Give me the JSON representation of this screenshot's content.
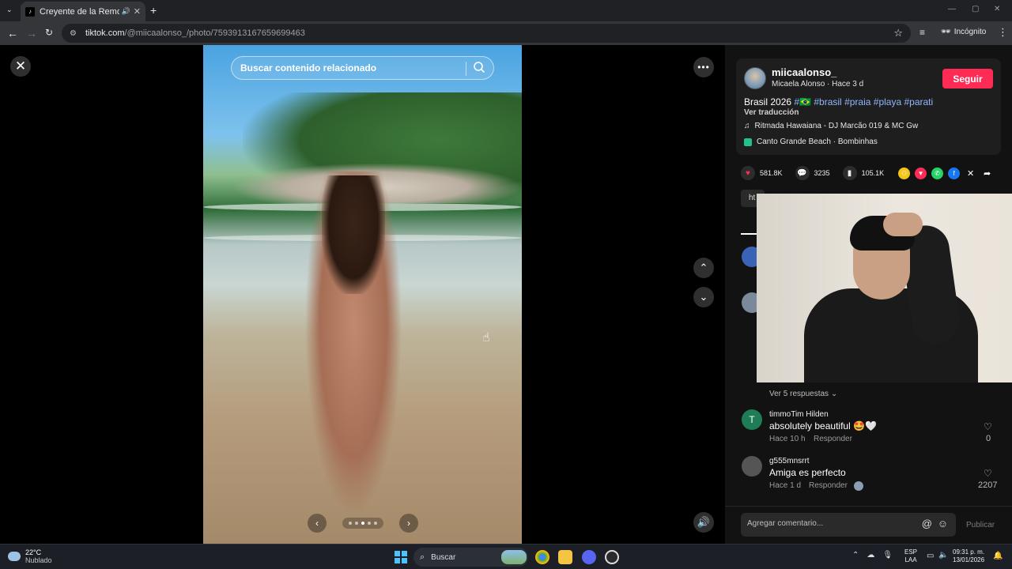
{
  "browser": {
    "tab_title": "Creyente de la Remontado",
    "url_host": "tiktok.com",
    "url_path": "/@miicaalonso_/photo/7593913167659699463",
    "incognito_label": "Incógnito"
  },
  "photo": {
    "search_placeholder": "Buscar contenido relacionado",
    "carousel_total": 5,
    "carousel_active": 3
  },
  "post": {
    "username": "miicaalonso_",
    "subtitle": "Micaela Alonso · Hace 3 d",
    "follow_label": "Seguir",
    "caption_text": "Brasil 2026",
    "hashtags": [
      "#🇧🇷",
      "#brasil",
      "#praia",
      "#playa",
      "#parati"
    ],
    "translate_label": "Ver traducción",
    "music": "Ritmada Hawaiana - DJ Marcão 019 & MC Gw",
    "location": "Canto Grande Beach · Bombinhas",
    "likes": "581.8K",
    "comments": "3235",
    "saves": "105.1K",
    "link_stub": "ht"
  },
  "comments": {
    "replies_label": "Ver 5 respuestas",
    "items": [
      {
        "author": "timmoTim Hilden",
        "avatar_letter": "T",
        "text": "absolutely beautiful 🤩🤍",
        "time": "Hace 10 h",
        "reply": "Responder",
        "likes": "0"
      },
      {
        "author": "g555mnsrrt",
        "avatar_letter": "",
        "text": "Amiga es perfecto",
        "time": "Hace 1 d",
        "reply": "Responder",
        "likes": "2207"
      }
    ],
    "input_placeholder": "Agregar comentario...",
    "publish_label": "Publicar"
  },
  "taskbar": {
    "temp": "22°C",
    "weather": "Nublado",
    "search_label": "Buscar",
    "lang_line1": "ESP",
    "lang_line2": "LAA",
    "time": "09:31 p. m.",
    "date": "13/01/2026"
  },
  "colors": {
    "accent": "#fe2c55",
    "hashtag": "#8fb8ff",
    "panel_bg": "#121212"
  }
}
